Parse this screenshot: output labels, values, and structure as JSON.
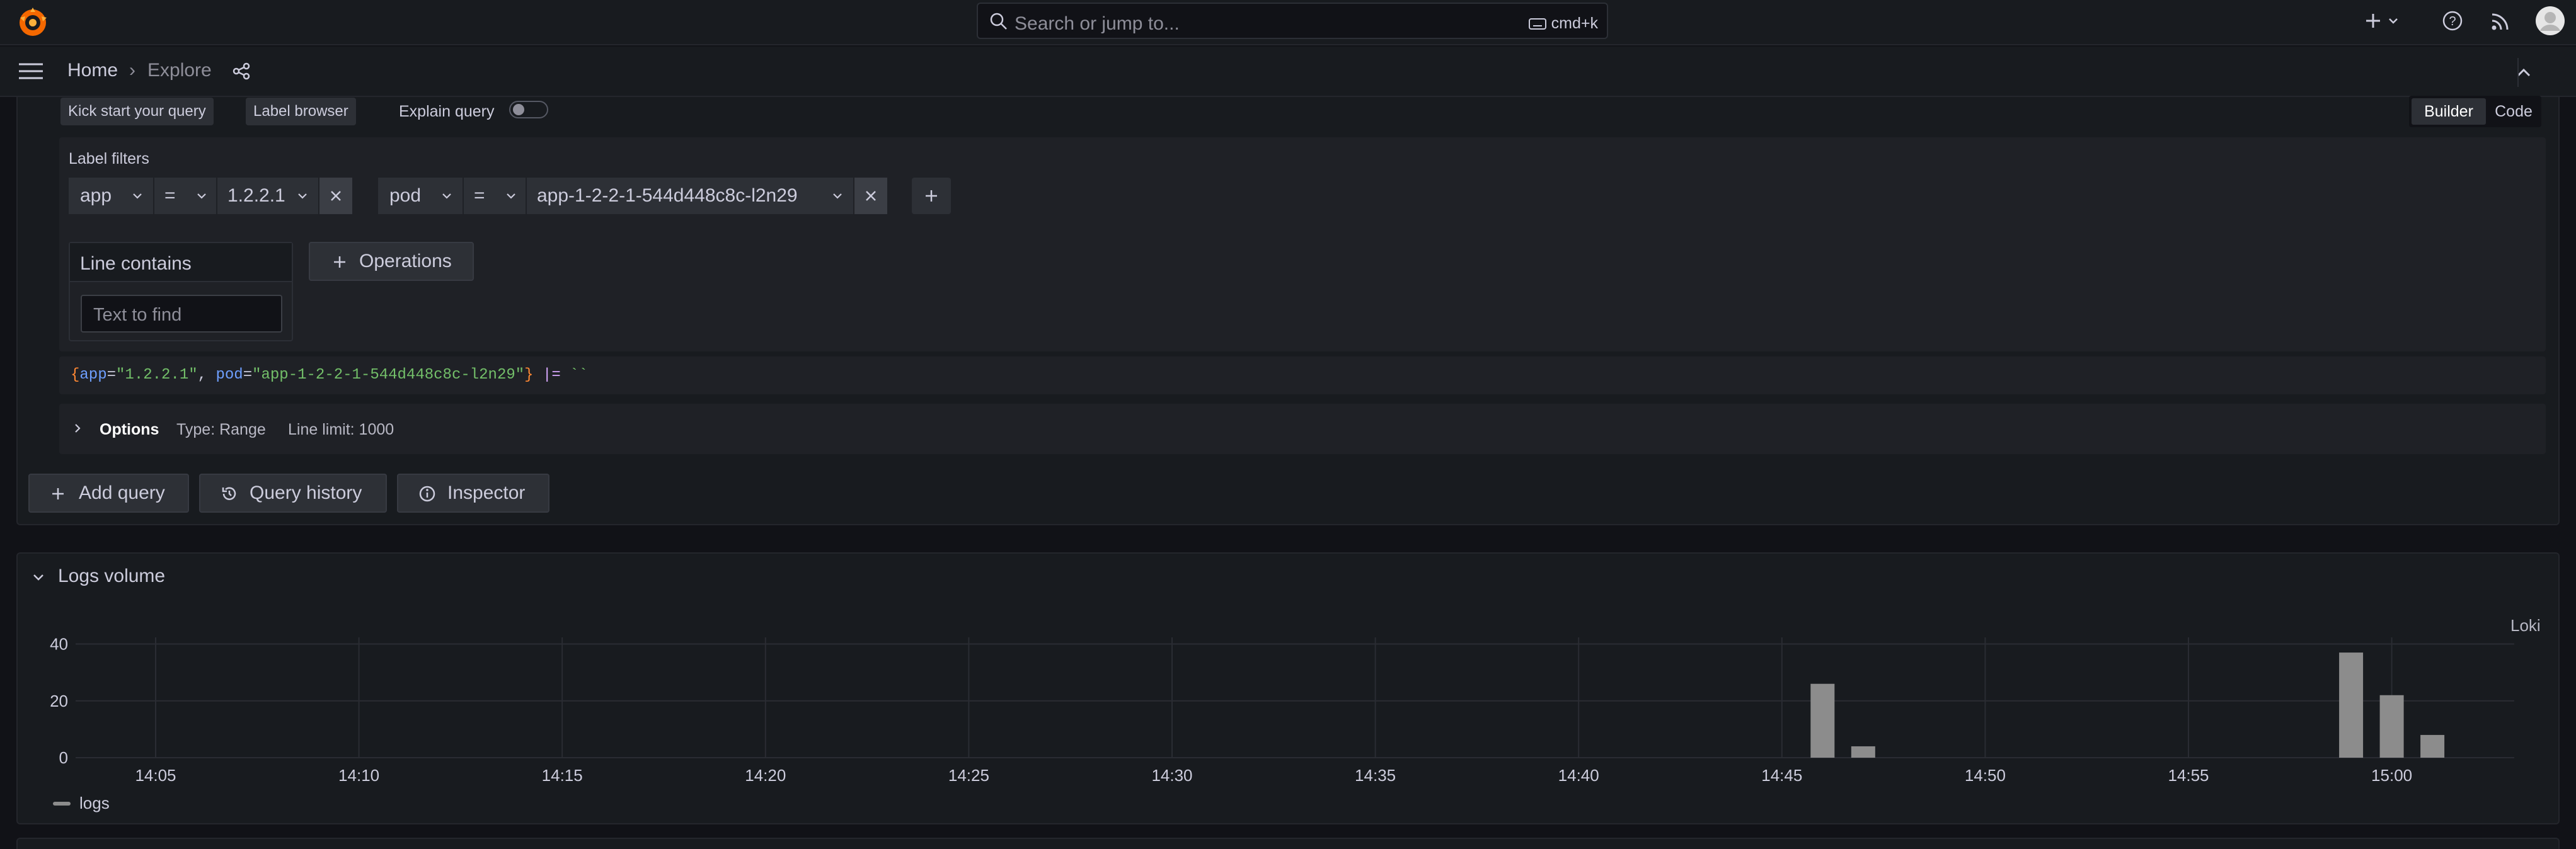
{
  "app": {
    "logo": "grafana-logo"
  },
  "topbar": {
    "search_placeholder": "Search or jump to...",
    "shortcut": "cmd+k",
    "icons": [
      "plus-icon",
      "chevron-down-icon",
      "help-icon",
      "rss-icon",
      "avatar"
    ]
  },
  "nav": {
    "breadcrumb": [
      "Home",
      "Explore"
    ],
    "separator": "›",
    "icons": [
      "menu-icon",
      "share-icon",
      "collapse-icon"
    ]
  },
  "query": {
    "kick_start_label": "Kick start your query",
    "label_browser_label": "Label browser",
    "explain_label": "Explain query",
    "explain_enabled": false,
    "modes": [
      "Builder",
      "Code"
    ],
    "active_mode": "Builder",
    "label_filters_title": "Label filters",
    "filters": [
      {
        "label": "app",
        "op": "=",
        "value": "1.2.2.1"
      },
      {
        "label": "pod",
        "op": "=",
        "value": "app-1-2-2-1-544d448c8c-l2n29"
      }
    ],
    "line_contains_title": "Line contains",
    "line_contains_placeholder": "Text to find",
    "operations_label": "Operations",
    "raw_query": {
      "open": "{",
      "k1": "app",
      "eq1": "=",
      "v1": "\"1.2.2.1\"",
      "comma": ",",
      "k2": "pod",
      "eq2": "=",
      "v2": "\"app-1-2-2-1-544d448c8c-l2n29\"",
      "close": "}",
      "pipe": "|=",
      "str": "``"
    },
    "options_label": "Options",
    "options_type": "Type: Range",
    "options_limit": "Line limit: 1000"
  },
  "actions": {
    "add_query": "Add query",
    "query_history": "Query history",
    "inspector": "Inspector"
  },
  "logs_volume": {
    "title": "Logs volume",
    "datasource": "Loki"
  },
  "colors": {
    "accent": "#ff8833",
    "bars": "#8c8c8c",
    "background": "#111217",
    "panel": "#181b1f"
  },
  "chart_data": {
    "type": "bar",
    "x_ticks": [
      "14:05",
      "14:10",
      "14:15",
      "14:20",
      "14:25",
      "14:30",
      "14:35",
      "14:40",
      "14:45",
      "14:50",
      "14:55",
      "15:00"
    ],
    "y_ticks": [
      0,
      20,
      40
    ],
    "ylim": [
      0,
      45
    ],
    "grid": true,
    "legend_position": "bottom-left",
    "series": [
      {
        "name": "logs",
        "points": [
          {
            "x": "14:46",
            "y": 26
          },
          {
            "x": "14:47",
            "y": 4
          },
          {
            "x": "14:59",
            "y": 37
          },
          {
            "x": "15:00",
            "y": 22
          },
          {
            "x": "15:01",
            "y": 8
          }
        ]
      }
    ]
  }
}
